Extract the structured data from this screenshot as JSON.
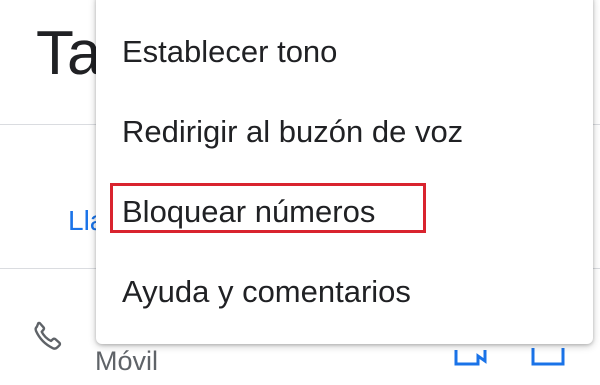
{
  "background": {
    "title_partial": "Ta",
    "link_partial": "Lla",
    "phone_type": "Móvil",
    "icons": [
      "phone-icon",
      "video-call-icon",
      "message-icon"
    ]
  },
  "menu": {
    "items": [
      {
        "label": "Establecer tono"
      },
      {
        "label": "Redirigir al buzón de voz"
      },
      {
        "label": "Bloquear números"
      },
      {
        "label": "Ayuda y comentarios"
      }
    ],
    "highlighted_item": "Bloquear números",
    "highlight_color": "#d9232e"
  },
  "colors": {
    "text_primary": "#202124",
    "link": "#1a73e8",
    "divider": "#dadce0"
  }
}
